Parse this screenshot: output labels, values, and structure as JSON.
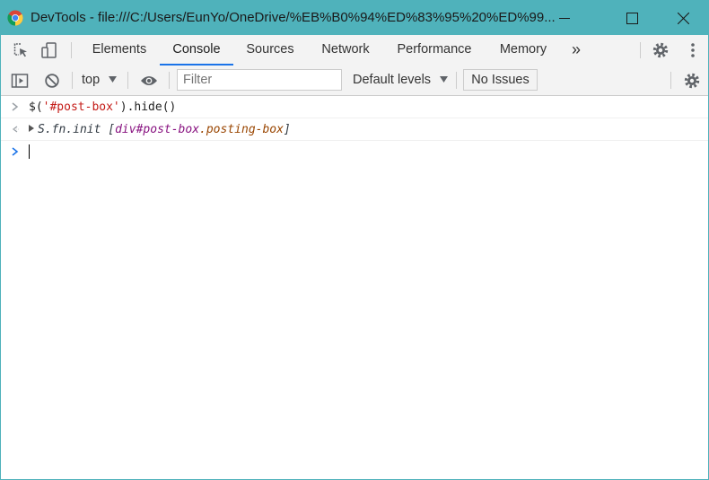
{
  "window": {
    "title": "DevTools - file:///C:/Users/EunYo/OneDrive/%EB%B0%94%ED%83%95%20%ED%99...",
    "accent_color": "#4fb2bb"
  },
  "tabs": {
    "items": [
      {
        "label": "Elements"
      },
      {
        "label": "Console"
      },
      {
        "label": "Sources"
      },
      {
        "label": "Network"
      },
      {
        "label": "Performance"
      },
      {
        "label": "Memory"
      }
    ],
    "more_label": "»",
    "active": "Console",
    "active_color": "#1a73e8"
  },
  "console_toolbar": {
    "context": "top",
    "filter_placeholder": "Filter",
    "levels": "Default levels",
    "issues": "No Issues"
  },
  "console": {
    "input": {
      "prefix": "$(",
      "string": "'#post-box'",
      "suffix": ").hide()"
    },
    "output": {
      "obj": "S.fn.init ",
      "open": "[",
      "tag": "div#post-box",
      "class": ".posting-box",
      "close": "]"
    }
  },
  "icons": [
    "chrome-logo-icon",
    "minimize-icon",
    "maximize-icon",
    "close-icon",
    "inspect-element-icon",
    "device-toolbar-icon",
    "settings-gear-icon",
    "kebab-menu-icon",
    "sidebar-toggle-icon",
    "clear-console-icon",
    "dropdown-arrow-icon",
    "eye-icon",
    "prompt-chevron-icon",
    "result-arrow-icon",
    "expand-triangle-icon"
  ]
}
